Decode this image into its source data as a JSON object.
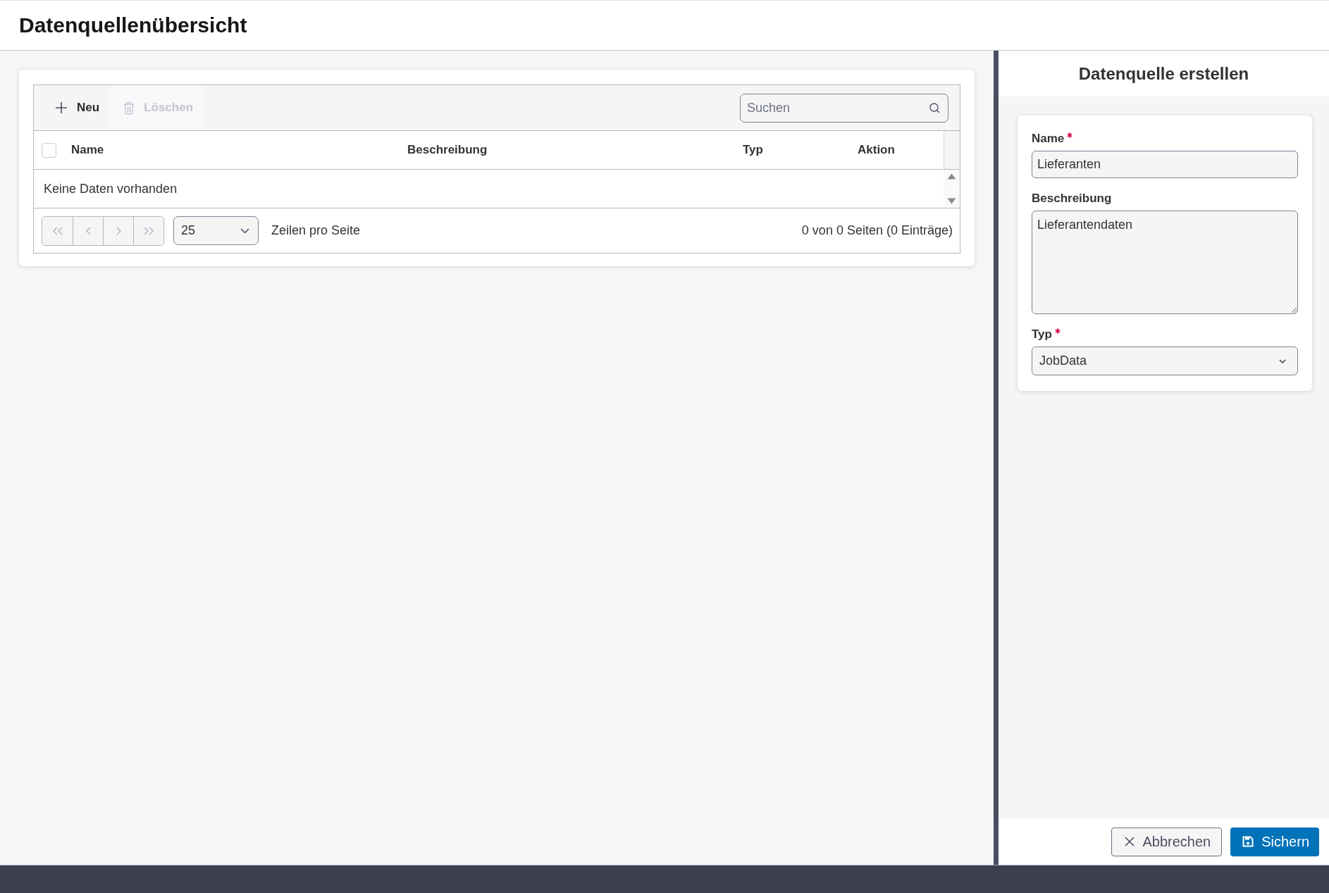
{
  "page": {
    "title": "Datenquellenübersicht"
  },
  "toolbar": {
    "buttons": [
      {
        "kind": "add",
        "label": "Neu",
        "disabled": false
      },
      {
        "kind": "delete",
        "label": "Löschen",
        "disabled": true
      }
    ],
    "search": {
      "placeholder": "Suchen"
    }
  },
  "table": {
    "select_all": {
      "checked": false
    },
    "columns": [
      "Name",
      "Beschreibung",
      "Typ",
      "Aktion"
    ],
    "empty_message": "Keine Daten vorhanden"
  },
  "pager": {
    "buttons": [
      {
        "kind": "first",
        "disabled": true
      },
      {
        "kind": "previous",
        "disabled": true
      },
      {
        "kind": "next",
        "disabled": true
      },
      {
        "kind": "last",
        "disabled": true
      }
    ],
    "page_size": "25",
    "page_size_label": "Zeilen pro Seite",
    "summary": "0 von 0 Seiten (0 Einträge)"
  },
  "panel": {
    "title": "Datenquelle erstellen",
    "fields": [
      {
        "kind": "text",
        "label": "Name",
        "required": true,
        "value": "Lieferanten"
      },
      {
        "kind": "textarea",
        "label": "Beschreibung",
        "required": false,
        "value": "Lieferantendaten"
      },
      {
        "kind": "select",
        "label": "Typ",
        "required": true,
        "value": "JobData"
      }
    ],
    "buttons": [
      {
        "kind": "cancel",
        "label": "Abbrechen"
      },
      {
        "kind": "save",
        "label": "Sichern"
      }
    ]
  }
}
